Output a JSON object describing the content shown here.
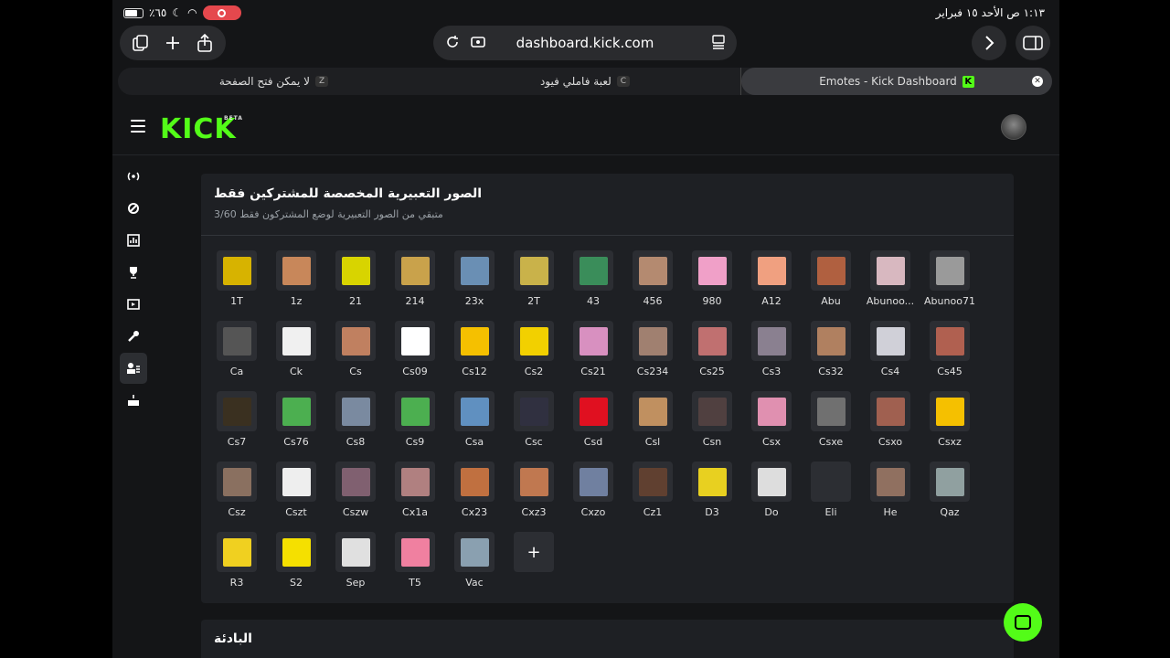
{
  "status": {
    "time_date": "١:١٣ ص  الأحد ١٥ فبراير",
    "battery_pct": "٪٦٥"
  },
  "toolbar": {
    "url": "dashboard.kick.com"
  },
  "tabs": [
    {
      "title": "لا يمكن فتح الصفحة",
      "key": "Z"
    },
    {
      "title": "لعبة فاملي فيود",
      "key": "C"
    },
    {
      "title": "Emotes - Kick Dashboard",
      "key": "K",
      "active": true
    }
  ],
  "header": {
    "logo": "KICK",
    "logo_badge": "BETA"
  },
  "rail_icons": [
    "broadcast-icon",
    "link-icon",
    "chart-icon",
    "trophy-icon",
    "video-icon",
    "wrench-icon",
    "users-icon",
    "cake-icon"
  ],
  "card": {
    "title": "الصور التعبيرية المخصصة للمشتركين فقط",
    "subtitle": "متبقي من الصور التعبيرية لوضع المشتركون فقط 3/60"
  },
  "emotes": [
    {
      "label": "1T",
      "color": "#d7b300"
    },
    {
      "label": "1z",
      "color": "#c8875a"
    },
    {
      "label": "21",
      "color": "#d8d400"
    },
    {
      "label": "214",
      "color": "#c9a24b"
    },
    {
      "label": "23x",
      "color": "#6a8fb4"
    },
    {
      "label": "2T",
      "color": "#c9b24a"
    },
    {
      "label": "43",
      "color": "#3a8d5a"
    },
    {
      "label": "456",
      "color": "#b48a70"
    },
    {
      "label": "980",
      "color": "#f0a0c8"
    },
    {
      "label": "A12",
      "color": "#f0a080"
    },
    {
      "label": "Abu",
      "color": "#b06040"
    },
    {
      "label": "Abunoo...",
      "color": "#d8b8c0"
    },
    {
      "label": "Abunoo71",
      "color": "#9a9a9a"
    },
    {
      "label": "Ca",
      "color": "#555555"
    },
    {
      "label": "Ck",
      "color": "#f0f0f0"
    },
    {
      "label": "Cs",
      "color": "#c08060"
    },
    {
      "label": "Cs09",
      "color": "#ffffff"
    },
    {
      "label": "Cs12",
      "color": "#f5c000"
    },
    {
      "label": "Cs2",
      "color": "#f2d000"
    },
    {
      "label": "Cs21",
      "color": "#d890c0"
    },
    {
      "label": "Cs234",
      "color": "#a08070"
    },
    {
      "label": "Cs25",
      "color": "#c07070"
    },
    {
      "label": "Cs3",
      "color": "#8a8090"
    },
    {
      "label": "Cs32",
      "color": "#b08060"
    },
    {
      "label": "Cs4",
      "color": "#d0d0d8"
    },
    {
      "label": "Cs45",
      "color": "#b06050"
    },
    {
      "label": "Cs7",
      "color": "#3a3020"
    },
    {
      "label": "Cs76",
      "color": "#4caf50"
    },
    {
      "label": "Cs8",
      "color": "#7a8aa0"
    },
    {
      "label": "Cs9",
      "color": "#4caf50"
    },
    {
      "label": "Csa",
      "color": "#6090c0"
    },
    {
      "label": "Csc",
      "color": "#303040"
    },
    {
      "label": "Csd",
      "color": "#e01020"
    },
    {
      "label": "Csl",
      "color": "#c09060"
    },
    {
      "label": "Csn",
      "color": "#504040"
    },
    {
      "label": "Csx",
      "color": "#e090b0"
    },
    {
      "label": "Csxe",
      "color": "#707070"
    },
    {
      "label": "Csxo",
      "color": "#a06050"
    },
    {
      "label": "Csxz",
      "color": "#f5c000"
    },
    {
      "label": "Csz",
      "color": "#8a7060"
    },
    {
      "label": "Cszt",
      "color": "#eeeeee"
    },
    {
      "label": "Cszw",
      "color": "#806070"
    },
    {
      "label": "Cx1a",
      "color": "#b08080"
    },
    {
      "label": "Cx23",
      "color": "#c07040"
    },
    {
      "label": "Cxz3",
      "color": "#c07850"
    },
    {
      "label": "Cxzo",
      "color": "#7080a0"
    },
    {
      "label": "Cz1",
      "color": "#604030"
    },
    {
      "label": "D3",
      "color": "#e8d020"
    },
    {
      "label": "Do",
      "color": "#dddddd"
    },
    {
      "label": "Eli",
      "color": "#2c2e33"
    },
    {
      "label": "He",
      "color": "#907060"
    },
    {
      "label": "Qaz",
      "color": "#90a0a0"
    },
    {
      "label": "R3",
      "color": "#f0d020"
    },
    {
      "label": "S2",
      "color": "#f5e000"
    },
    {
      "label": "Sep",
      "color": "#e0e0e0"
    },
    {
      "label": "T5",
      "color": "#f080a0"
    },
    {
      "label": "Vac",
      "color": "#8aa0b0"
    }
  ],
  "add_label": "+",
  "card2": {
    "title": "البادئة"
  }
}
